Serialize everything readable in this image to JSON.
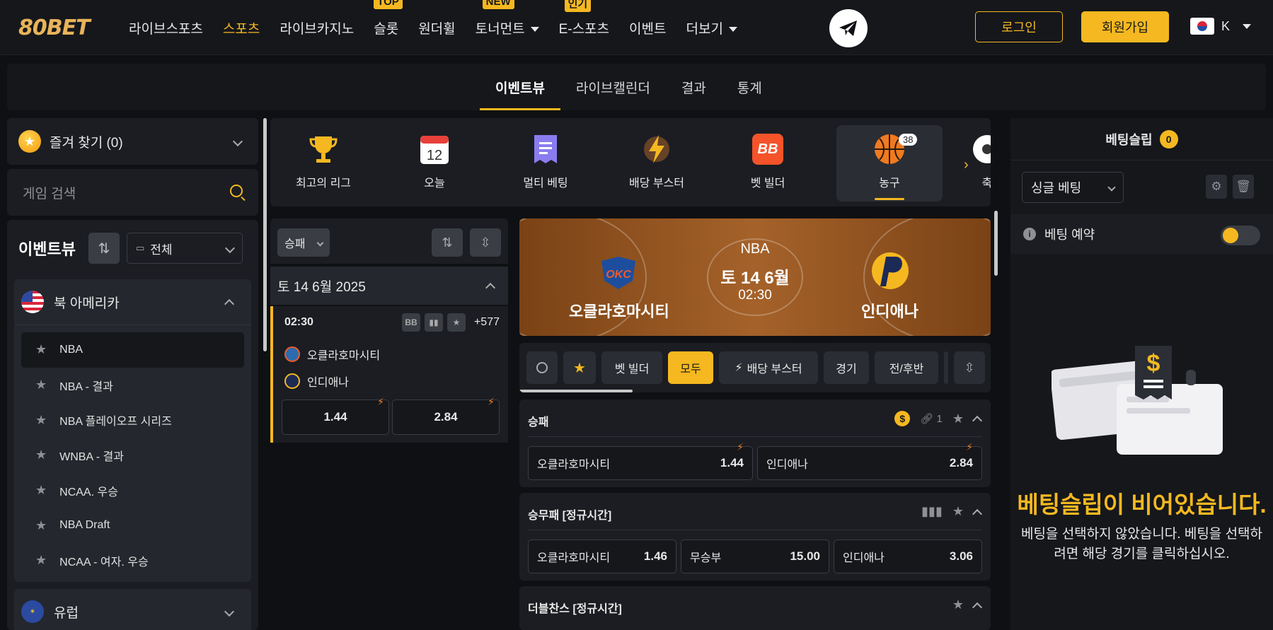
{
  "header": {
    "logo": "80BET",
    "nav": [
      {
        "label": "라이브스포츠",
        "badge": ""
      },
      {
        "label": "스포츠",
        "badge": "",
        "active": true
      },
      {
        "label": "라이브카지노",
        "badge": ""
      },
      {
        "label": "슬롯",
        "badge": "TOP"
      },
      {
        "label": "원더휠",
        "badge": ""
      },
      {
        "label": "토너먼트",
        "badge": "NEW"
      },
      {
        "label": "E-스포츠",
        "badge": "인기"
      },
      {
        "label": "이벤트",
        "badge": ""
      },
      {
        "label": "더보기",
        "badge": ""
      }
    ],
    "login": "로그인",
    "join": "회원가입",
    "lang": "K"
  },
  "tabs": [
    "이벤트뷰",
    "라이브캘린더",
    "결과",
    "통계"
  ],
  "sidebar": {
    "favorites": "즐겨 찾기 (0)",
    "search_placeholder": "게임 검색",
    "event_title": "이벤트뷰",
    "date_filter": "전체",
    "region_na": "북 아메리카",
    "leagues": [
      "NBA",
      "NBA - 결과",
      "NBA 플레이오프 시리즈",
      "WNBA - 결과",
      "NCAA. 우승",
      "NBA Draft",
      "NCAA - 여자. 우승"
    ],
    "region_eu": "유럽"
  },
  "sports": [
    {
      "label": "최고의 리그",
      "icon": "trophy-icon"
    },
    {
      "label": "오늘",
      "icon": "calendar-icon",
      "day": "12"
    },
    {
      "label": "멀티 베팅",
      "icon": "ticket-icon"
    },
    {
      "label": "배당 부스터",
      "icon": "lightning-icon"
    },
    {
      "label": "벳 빌더",
      "icon": "bb-icon",
      "text": "BB"
    },
    {
      "label": "농구",
      "icon": "basketball-icon",
      "count": "38",
      "active": true
    },
    {
      "label": "축",
      "icon": "soccer-icon"
    }
  ],
  "matchlist": {
    "filter": "승패",
    "date": "토 14 6월 2025",
    "time": "02:30",
    "more": "+577",
    "home": "오클라호마시티",
    "away": "인디애나",
    "odds_home": "1.44",
    "odds_away": "2.84",
    "bb": "BB"
  },
  "banner": {
    "league": "NBA",
    "date": "토 14 6월",
    "time": "02:30",
    "home": "오클라호마시티",
    "away": "인디애나"
  },
  "filters": [
    "벳 빌더",
    "모두",
    "배당 부스터",
    "경기",
    "전/후반"
  ],
  "markets": {
    "m1": {
      "title": "승패",
      "links": "1",
      "home": "오클라호마시티",
      "home_odds": "1.44",
      "away": "인디애나",
      "away_odds": "2.84"
    },
    "m2": {
      "title": "승무패 [정규시간]",
      "home": "오클라호마시티",
      "home_odds": "1.46",
      "draw": "무승부",
      "draw_odds": "15.00",
      "away": "인디애나",
      "away_odds": "3.06"
    },
    "m3": {
      "title": "더블찬스 [정규시간]"
    }
  },
  "betslip": {
    "title": "베팅슬립",
    "count": "0",
    "type": "싱글 베팅",
    "reserve": "베팅 예약",
    "empty_title": "베팅슬립이 비어있습니다.",
    "empty_desc": "베팅을 선택하지 않았습니다. 베팅을 선택하려면 해당 경기를 클릭하십시오."
  },
  "colors": {
    "accent": "#f5b820",
    "bg": "#0e1013",
    "panel": "#1b1d22"
  }
}
